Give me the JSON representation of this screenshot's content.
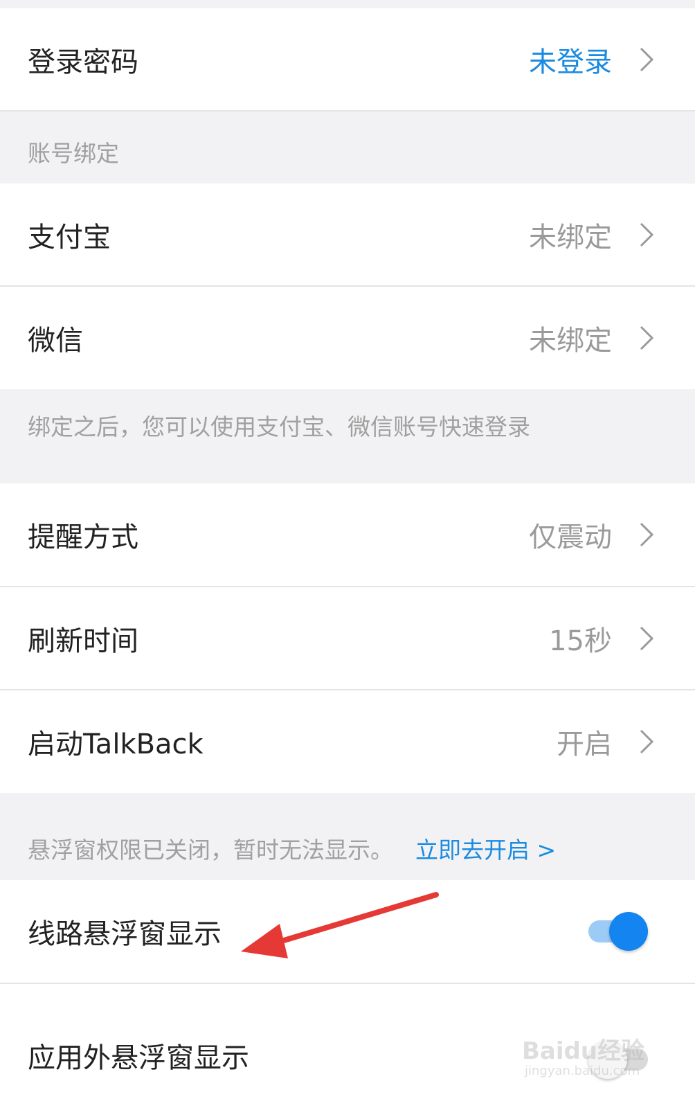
{
  "rows": {
    "login_password": {
      "label": "登录密码",
      "value": "未登录"
    },
    "alipay": {
      "label": "支付宝",
      "value": "未绑定"
    },
    "wechat": {
      "label": "微信",
      "value": "未绑定"
    },
    "reminder": {
      "label": "提醒方式",
      "value": "仅震动"
    },
    "refresh": {
      "label": "刷新时间",
      "value": "15秒"
    },
    "talkback": {
      "label": "启动TalkBack",
      "value": "开启"
    },
    "route_float": {
      "label": "线路悬浮窗显示",
      "toggle": "on"
    },
    "app_float": {
      "label": "应用外悬浮窗显示",
      "toggle": "off"
    }
  },
  "sections": {
    "account_binding_header": "账号绑定",
    "binding_hint": "绑定之后，您可以使用支付宝、微信账号快速登录",
    "float_permission_notice": "悬浮窗权限已关闭，暂时无法显示。",
    "float_permission_link": "立即去开启 >"
  },
  "watermark": {
    "logo": "Baidu经验",
    "url": "jingyan.baidu.com"
  },
  "colors": {
    "accent_blue": "#1a8be0",
    "toggle_on": "#1384f0",
    "arrow_red": "#e53935"
  },
  "icons": [
    "chevron-right-icon",
    "red-arrow-annotation"
  ]
}
